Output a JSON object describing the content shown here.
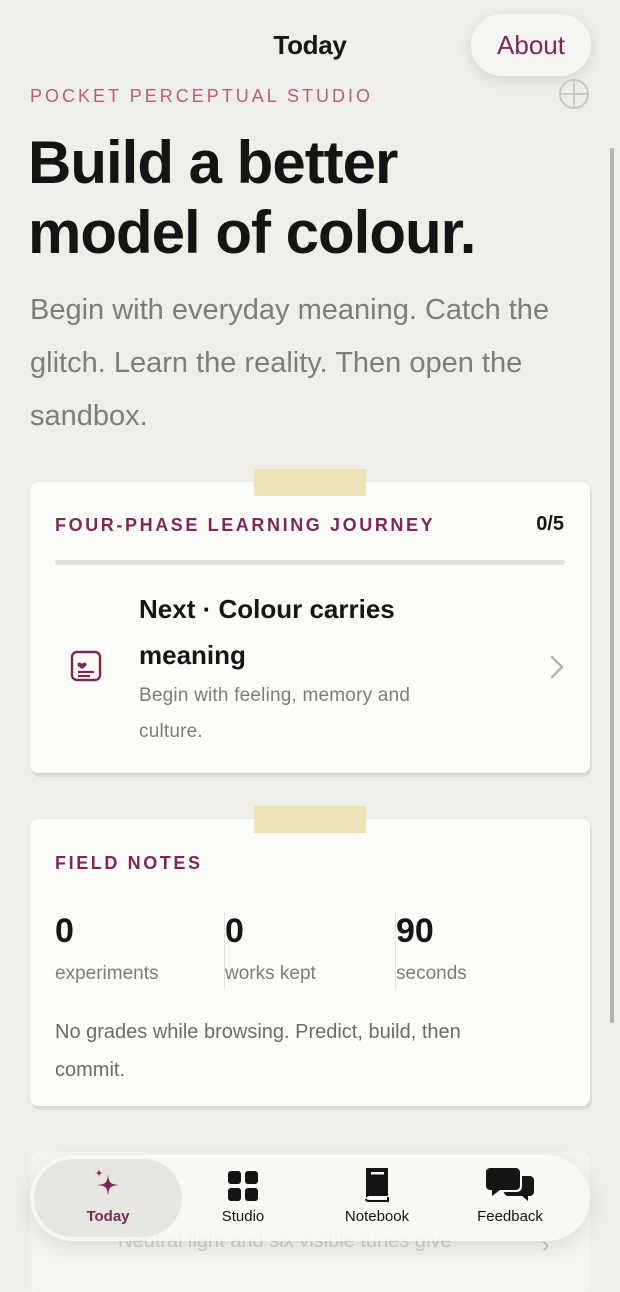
{
  "nav": {
    "title": "Today",
    "about_label": "About"
  },
  "hero": {
    "eyebrow": "POCKET PERCEPTUAL STUDIO",
    "headline_line1": "Build a better",
    "headline_line2": "model of colour.",
    "intro": "Begin with everyday meaning. Catch the glitch. Learn the reality. Then open the sandbox."
  },
  "journey": {
    "label": "FOUR-PHASE LEARNING JOURNEY",
    "count": "0/5",
    "progress_fraction": 0,
    "next_title": "Next · Colour carries meaning",
    "next_desc": "Begin with feeling, memory and culture."
  },
  "field_notes": {
    "label": "FIELD NOTES",
    "stats": [
      {
        "value": "0",
        "label": "experiments"
      },
      {
        "value": "0",
        "label": "works kept"
      },
      {
        "value": "90",
        "label": "seconds"
      }
    ],
    "footer": "No grades while browsing. Predict, build, then commit."
  },
  "peek_card": {
    "text": "Neutral light and six visible tunes give"
  },
  "tabs": [
    {
      "label": "Today",
      "icon": "sparkles-icon",
      "active": true
    },
    {
      "label": "Studio",
      "icon": "grid-icon",
      "active": false
    },
    {
      "label": "Notebook",
      "icon": "book-icon",
      "active": false
    },
    {
      "label": "Feedback",
      "icon": "chat-bubbles-icon",
      "active": false
    }
  ],
  "colors": {
    "accent": "#7a2a55",
    "eyebrow": "#b2607f",
    "tape": "#ece2b4",
    "background": "#efeee9"
  }
}
